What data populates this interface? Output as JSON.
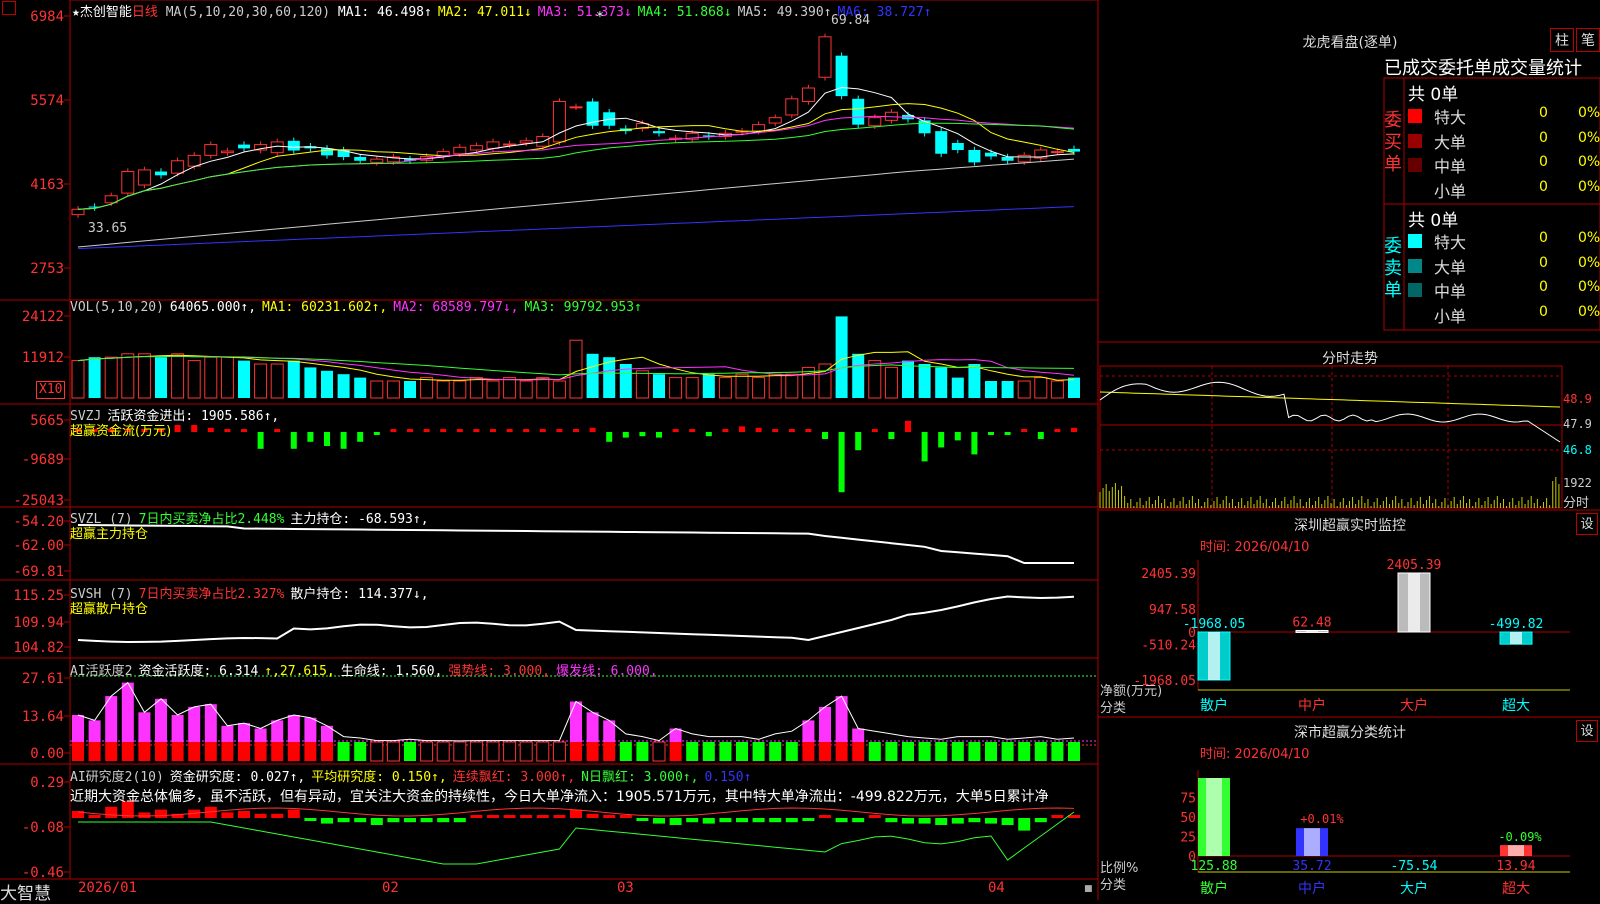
{
  "window": {
    "brand": "大智慧"
  },
  "stock": {
    "prefix": "★",
    "name": "杰创智能",
    "period": "日线"
  },
  "main": {
    "ma_params": "MA(5,10,20,30,60,120)",
    "ma_items": [
      {
        "label": "MA1: 46.498",
        "arrow": "↑",
        "color": "#ffffff"
      },
      {
        "label": "MA2: 47.011",
        "arrow": "↓",
        "color": "#ffff00"
      },
      {
        "label": "MA3: 51.373",
        "arrow": "↓",
        "color": "#ff33ff"
      },
      {
        "label": "MA4: 51.868",
        "arrow": "↓",
        "color": "#33ff33"
      },
      {
        "label": "MA5: 49.390",
        "arrow": "↑",
        "color": "#cccccc"
      },
      {
        "label": "MA6: 38.727",
        "arrow": "↑",
        "color": "#3333ff"
      }
    ],
    "y_ticks": [
      "6984",
      "5574",
      "4163",
      "2753"
    ],
    "high_label": "69.84",
    "low_label": "33.65",
    "star_mark": "*"
  },
  "vol": {
    "header": [
      {
        "text": "VOL(5,10,20)",
        "color": "#cccccc"
      },
      {
        "text": "64065.000↑,",
        "color": "#ffffff"
      },
      {
        "text": "MA1: 60231.602↑,",
        "color": "#ffff00"
      },
      {
        "text": "MA2: 68589.797↓,",
        "color": "#ff33ff"
      },
      {
        "text": "MA3: 99792.953↑",
        "color": "#33ff33"
      }
    ],
    "y_ticks": [
      "24122",
      "11912"
    ],
    "unit": "X10"
  },
  "svzj": {
    "header1": [
      {
        "text": "SVZJ",
        "color": "#cccccc"
      },
      {
        "text": "活跃资金进出: 1905.586↑,",
        "color": "#ffffff"
      }
    ],
    "header2": "超赢资金流(万元)",
    "y_ticks": [
      "5665",
      "-9689",
      "-25043"
    ]
  },
  "svzl": {
    "header1": [
      {
        "text": "SVZL (7)",
        "color": "#cccccc"
      },
      {
        "text": "7日内买卖净占比2.448%",
        "color": "#33ff33"
      },
      {
        "text": "主力持仓: -68.593↑,",
        "color": "#ffffff"
      }
    ],
    "header2": "超赢主力持仓",
    "y_ticks": [
      "-54.20",
      "-62.00",
      "-69.81"
    ]
  },
  "svsh": {
    "header1": [
      {
        "text": "SVSH (7)",
        "color": "#cccccc"
      },
      {
        "text": "7日内买卖净占比2.327%",
        "color": "#ff3333"
      },
      {
        "text": "散户持仓: 114.377↓,",
        "color": "#ffffff"
      }
    ],
    "header2": "超赢散户持仓",
    "y_ticks": [
      "115.25",
      "109.94",
      "104.82"
    ]
  },
  "ai1": {
    "header": [
      {
        "text": "AI活跃度2",
        "color": "#cccccc"
      },
      {
        "text": "资金活跃度: 6.314",
        "color": "#ffffff"
      },
      {
        "text": "↑,27.615,",
        "color": "#ffff00"
      },
      {
        "text": "生命线: 1.560,",
        "color": "#ffffff"
      },
      {
        "text": "强势线: 3.000,",
        "color": "#ff3333"
      },
      {
        "text": "爆发线: 6.000,",
        "color": "#ff33ff"
      }
    ],
    "y_ticks": [
      "27.61",
      "13.64",
      "0.00"
    ]
  },
  "ai2": {
    "header": [
      {
        "text": "AI研究度2(10)",
        "color": "#cccccc"
      },
      {
        "text": "资金研究度: 0.027↑,",
        "color": "#ffffff"
      },
      {
        "text": "平均研究度: 0.150↑,",
        "color": "#ffff00"
      },
      {
        "text": "连续飘红: 3.000↑,",
        "color": "#ff3333"
      },
      {
        "text": "N日飘红: 3.000↑,",
        "color": "#33ff33"
      },
      {
        "text": "0.150↑",
        "color": "#3333ff"
      }
    ],
    "comment": "近期大资金总体偏多，虽不活跃，但有异动，宜关注大资金的持续性，今日大单净流入：1905.571万元，其中特大单净流出：-499.822万元，大单5日累计净",
    "y_ticks": [
      "0.29",
      "-0.08",
      "-0.46"
    ]
  },
  "xaxis": {
    "labels": [
      "2026/01",
      "02",
      "03",
      "04"
    ]
  },
  "right": {
    "title": "龙虎看盘(逐单)",
    "btn_bar": "柱",
    "btn_pen": "笔",
    "subtitle": "已成交委托单成交量统计",
    "buy_label": "委买单",
    "sell_label": "委卖单",
    "buy_total": "共 0单",
    "sell_total": "共 0单",
    "buy_rows": [
      {
        "name": "特大",
        "qty": "0",
        "pct": "0%",
        "color": "#ff0000"
      },
      {
        "name": "大单",
        "qty": "0",
        "pct": "0%",
        "color": "#990000"
      },
      {
        "name": "中单",
        "qty": "0",
        "pct": "0%",
        "color": "#660000"
      },
      {
        "name": "小单",
        "qty": "0",
        "pct": "0%",
        "color": "#000000"
      }
    ],
    "sell_rows": [
      {
        "name": "特大",
        "qty": "0",
        "pct": "0%",
        "color": "#00ffff"
      },
      {
        "name": "大单",
        "qty": "0",
        "pct": "0%",
        "color": "#008888"
      },
      {
        "name": "中单",
        "qty": "0",
        "pct": "0%",
        "color": "#006666"
      },
      {
        "name": "小单",
        "qty": "0",
        "pct": "0%",
        "color": "#000000"
      }
    ],
    "intraday": {
      "title": "分时走势",
      "prices": [
        "48.9",
        "47.9",
        "46.8"
      ],
      "vol_label": "1922",
      "unit_label": "分时"
    },
    "sz_monitor": {
      "title": "深圳超赢实时监控",
      "gear": "设",
      "time": "时间: 2026/04/10",
      "y_ticks": [
        "2405.39",
        "947.58",
        "0",
        "-510.24",
        "-1968.05"
      ],
      "y_title": "净额(万元)",
      "x_title": "分类",
      "categories": [
        "散户",
        "中户",
        "大户",
        "超大"
      ],
      "values": [
        -1968.05,
        62.48,
        2405.39,
        -499.82
      ],
      "value_labels": [
        "-1968.05",
        "62.48",
        "2405.39",
        "-499.82"
      ]
    },
    "sz_class": {
      "title": "深市超赢分类统计",
      "gear": "设",
      "time": "时间: 2026/04/10",
      "y_ticks": [
        "75",
        "50",
        "25",
        "0"
      ],
      "y_title": "比例%",
      "x_title": "分类",
      "categories": [
        "散户",
        "中户",
        "大户",
        "超大"
      ],
      "values": [
        125.88,
        35.72,
        -75.54,
        13.94
      ],
      "value_labels": [
        "125.88",
        "35.72",
        "-75.54",
        "13.94"
      ],
      "small_labels": [
        "+0.01%",
        "-0.09%"
      ]
    }
  }
}
